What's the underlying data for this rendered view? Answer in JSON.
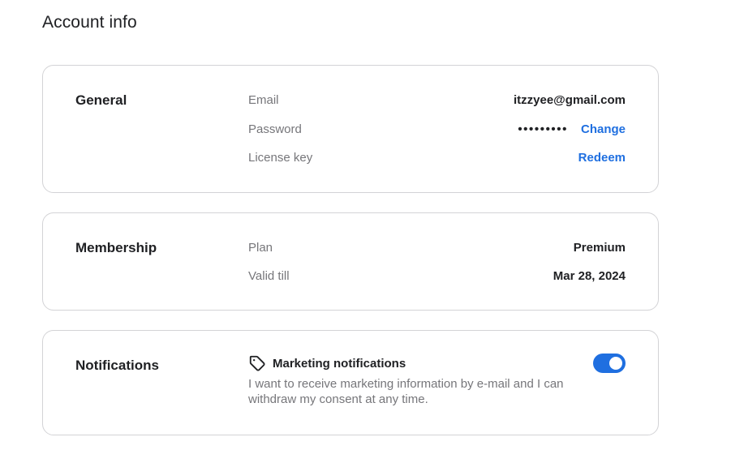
{
  "page": {
    "title": "Account info"
  },
  "general": {
    "title": "General",
    "email_label": "Email",
    "email_value": "itzzyee@gmail.com",
    "password_label": "Password",
    "password_mask": "•••••••••",
    "password_action": "Change",
    "license_label": "License key",
    "license_action": "Redeem"
  },
  "membership": {
    "title": "Membership",
    "plan_label": "Plan",
    "plan_value": "Premium",
    "valid_label": "Valid till",
    "valid_value": "Mar 28, 2024"
  },
  "notifications": {
    "title": "Notifications",
    "marketing_title": "Marketing notifications",
    "marketing_desc": "I want to receive marketing information by e-mail and I can withdraw my consent at any time.",
    "marketing_enabled": true,
    "icon": "tag-icon"
  },
  "colors": {
    "accent": "#1f6fe0",
    "muted": "#76767a",
    "border": "#d3d3d6",
    "text": "#202124"
  }
}
